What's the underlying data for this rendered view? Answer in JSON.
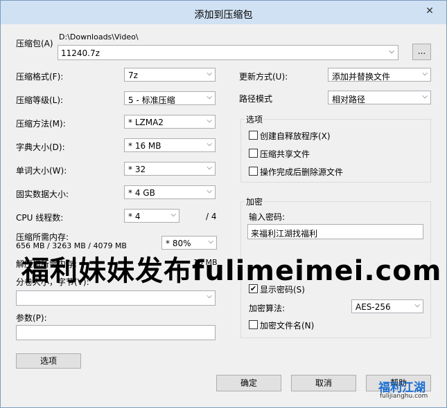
{
  "window": {
    "title": "添加到压缩包",
    "close": "✕"
  },
  "archive": {
    "label": "压缩包(A)",
    "path": "D:\\Downloads\\Video\\",
    "filename": "11240.7z",
    "browse": "..."
  },
  "left": {
    "format": {
      "label": "压缩格式(F):",
      "value": "7z"
    },
    "level": {
      "label": "压缩等级(L):",
      "value": "5 - 标准压缩"
    },
    "method": {
      "label": "压缩方法(M):",
      "value": "* LZMA2"
    },
    "dict": {
      "label": "字典大小(D):",
      "value": "* 16 MB"
    },
    "word": {
      "label": "单词大小(W):",
      "value": "* 32"
    },
    "solid": {
      "label": "固实数据大小:",
      "value": "* 4 GB"
    },
    "threads": {
      "label": "CPU 线程数:",
      "value": "* 4",
      "max": "/ 4"
    },
    "memory": {
      "label": "压缩所需内存:",
      "detail": "656 MB / 3263 MB / 4079 MB",
      "value": "* 80%"
    },
    "decomp": {
      "label": "解压缩所需内存:",
      "value": "18 MB"
    },
    "split": {
      "label": "分卷大小，字节(V):",
      "value": ""
    },
    "params": {
      "label": "参数(P):",
      "value": ""
    },
    "options_button": "选项"
  },
  "right": {
    "update": {
      "label": "更新方式(U):",
      "value": "添加并替换文件"
    },
    "pathmode": {
      "label": "路径模式",
      "value": "相对路径"
    },
    "options": {
      "title": "选项",
      "sfx": {
        "label": "创建自释放程序(X)",
        "checked": false
      },
      "shared": {
        "label": "压缩共享文件",
        "checked": false
      },
      "delete": {
        "label": "操作完成后删除源文件",
        "checked": false
      }
    },
    "encryption": {
      "title": "加密",
      "password_label": "输入密码:",
      "password_value": "来福利江湖找福利",
      "show_label": "显示密码(S)",
      "show_checked": true,
      "method_label": "加密算法:",
      "method_value": "AES-256",
      "encrypt_names_label": "加密文件名(N)",
      "encrypt_names_checked": false
    }
  },
  "footer": {
    "ok": "确定",
    "cancel": "取消",
    "help": "帮助"
  },
  "overlay": {
    "watermark": "福利妹妹发布fulimeimei.com",
    "logo_text": "福利江湖",
    "logo_url": "fulijianghu.com"
  }
}
